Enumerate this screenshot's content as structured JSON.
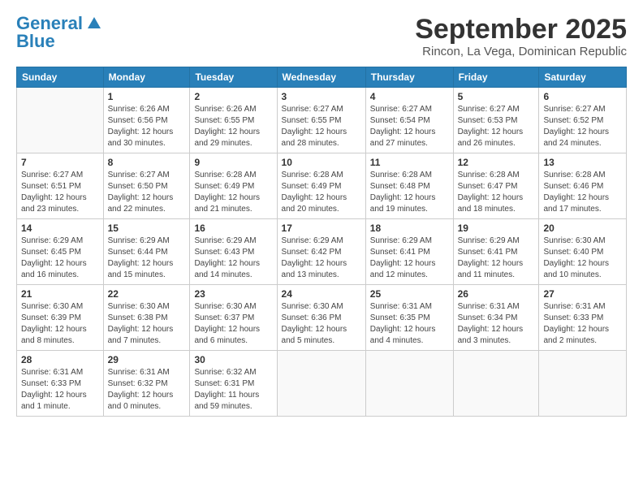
{
  "logo": {
    "line1": "General",
    "line2": "Blue"
  },
  "title": "September 2025",
  "location": "Rincon, La Vega, Dominican Republic",
  "weekdays": [
    "Sunday",
    "Monday",
    "Tuesday",
    "Wednesday",
    "Thursday",
    "Friday",
    "Saturday"
  ],
  "weeks": [
    [
      {
        "day": null,
        "info": null
      },
      {
        "day": "1",
        "info": "Sunrise: 6:26 AM\nSunset: 6:56 PM\nDaylight: 12 hours\nand 30 minutes."
      },
      {
        "day": "2",
        "info": "Sunrise: 6:26 AM\nSunset: 6:55 PM\nDaylight: 12 hours\nand 29 minutes."
      },
      {
        "day": "3",
        "info": "Sunrise: 6:27 AM\nSunset: 6:55 PM\nDaylight: 12 hours\nand 28 minutes."
      },
      {
        "day": "4",
        "info": "Sunrise: 6:27 AM\nSunset: 6:54 PM\nDaylight: 12 hours\nand 27 minutes."
      },
      {
        "day": "5",
        "info": "Sunrise: 6:27 AM\nSunset: 6:53 PM\nDaylight: 12 hours\nand 26 minutes."
      },
      {
        "day": "6",
        "info": "Sunrise: 6:27 AM\nSunset: 6:52 PM\nDaylight: 12 hours\nand 24 minutes."
      }
    ],
    [
      {
        "day": "7",
        "info": "Sunrise: 6:27 AM\nSunset: 6:51 PM\nDaylight: 12 hours\nand 23 minutes."
      },
      {
        "day": "8",
        "info": "Sunrise: 6:27 AM\nSunset: 6:50 PM\nDaylight: 12 hours\nand 22 minutes."
      },
      {
        "day": "9",
        "info": "Sunrise: 6:28 AM\nSunset: 6:49 PM\nDaylight: 12 hours\nand 21 minutes."
      },
      {
        "day": "10",
        "info": "Sunrise: 6:28 AM\nSunset: 6:49 PM\nDaylight: 12 hours\nand 20 minutes."
      },
      {
        "day": "11",
        "info": "Sunrise: 6:28 AM\nSunset: 6:48 PM\nDaylight: 12 hours\nand 19 minutes."
      },
      {
        "day": "12",
        "info": "Sunrise: 6:28 AM\nSunset: 6:47 PM\nDaylight: 12 hours\nand 18 minutes."
      },
      {
        "day": "13",
        "info": "Sunrise: 6:28 AM\nSunset: 6:46 PM\nDaylight: 12 hours\nand 17 minutes."
      }
    ],
    [
      {
        "day": "14",
        "info": "Sunrise: 6:29 AM\nSunset: 6:45 PM\nDaylight: 12 hours\nand 16 minutes."
      },
      {
        "day": "15",
        "info": "Sunrise: 6:29 AM\nSunset: 6:44 PM\nDaylight: 12 hours\nand 15 minutes."
      },
      {
        "day": "16",
        "info": "Sunrise: 6:29 AM\nSunset: 6:43 PM\nDaylight: 12 hours\nand 14 minutes."
      },
      {
        "day": "17",
        "info": "Sunrise: 6:29 AM\nSunset: 6:42 PM\nDaylight: 12 hours\nand 13 minutes."
      },
      {
        "day": "18",
        "info": "Sunrise: 6:29 AM\nSunset: 6:41 PM\nDaylight: 12 hours\nand 12 minutes."
      },
      {
        "day": "19",
        "info": "Sunrise: 6:29 AM\nSunset: 6:41 PM\nDaylight: 12 hours\nand 11 minutes."
      },
      {
        "day": "20",
        "info": "Sunrise: 6:30 AM\nSunset: 6:40 PM\nDaylight: 12 hours\nand 10 minutes."
      }
    ],
    [
      {
        "day": "21",
        "info": "Sunrise: 6:30 AM\nSunset: 6:39 PM\nDaylight: 12 hours\nand 8 minutes."
      },
      {
        "day": "22",
        "info": "Sunrise: 6:30 AM\nSunset: 6:38 PM\nDaylight: 12 hours\nand 7 minutes."
      },
      {
        "day": "23",
        "info": "Sunrise: 6:30 AM\nSunset: 6:37 PM\nDaylight: 12 hours\nand 6 minutes."
      },
      {
        "day": "24",
        "info": "Sunrise: 6:30 AM\nSunset: 6:36 PM\nDaylight: 12 hours\nand 5 minutes."
      },
      {
        "day": "25",
        "info": "Sunrise: 6:31 AM\nSunset: 6:35 PM\nDaylight: 12 hours\nand 4 minutes."
      },
      {
        "day": "26",
        "info": "Sunrise: 6:31 AM\nSunset: 6:34 PM\nDaylight: 12 hours\nand 3 minutes."
      },
      {
        "day": "27",
        "info": "Sunrise: 6:31 AM\nSunset: 6:33 PM\nDaylight: 12 hours\nand 2 minutes."
      }
    ],
    [
      {
        "day": "28",
        "info": "Sunrise: 6:31 AM\nSunset: 6:33 PM\nDaylight: 12 hours\nand 1 minute."
      },
      {
        "day": "29",
        "info": "Sunrise: 6:31 AM\nSunset: 6:32 PM\nDaylight: 12 hours\nand 0 minutes."
      },
      {
        "day": "30",
        "info": "Sunrise: 6:32 AM\nSunset: 6:31 PM\nDaylight: 11 hours\nand 59 minutes."
      },
      {
        "day": null,
        "info": null
      },
      {
        "day": null,
        "info": null
      },
      {
        "day": null,
        "info": null
      },
      {
        "day": null,
        "info": null
      }
    ]
  ]
}
